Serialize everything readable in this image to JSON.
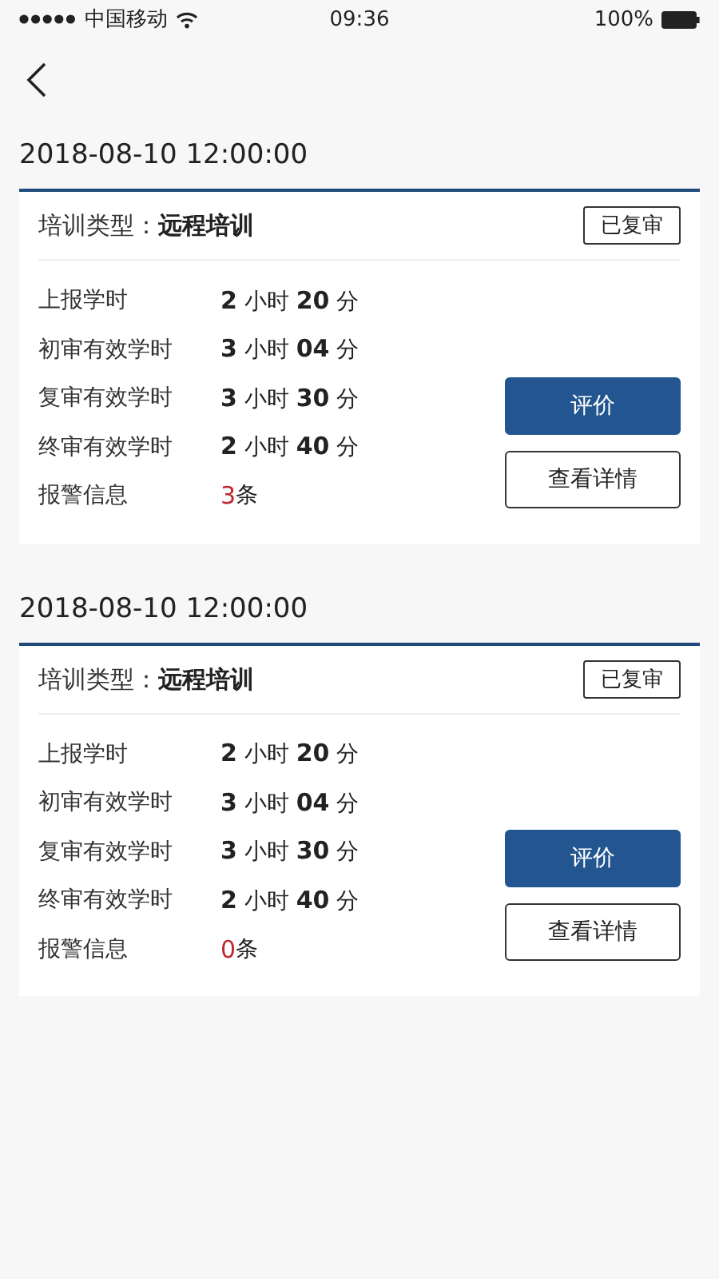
{
  "status_bar": {
    "carrier": "中国移动",
    "time": "09:36",
    "battery": "100%"
  },
  "records": [
    {
      "date": "2018-08-10  12:00:00",
      "type_label": "培训类型：",
      "type_value": "远程培训",
      "status": "已复审",
      "rows": [
        {
          "label": "上报学时",
          "value": "**2** 小时 **20** 分"
        },
        {
          "label": "初审有效学时",
          "value": "**3** 小时 **04** 分"
        },
        {
          "label": "复审有效学时",
          "value": "**3** 小时 **30** 分"
        },
        {
          "label": "终审有效学时",
          "value": "**2** 小时 **40** 分"
        }
      ],
      "alarm": {
        "label": "报警信息",
        "count": "3",
        "unit": "条"
      },
      "buttons": [
        "评价",
        "查看详情"
      ]
    },
    {
      "date": "2018-08-10  12:00:00",
      "type_label": "培训类型：",
      "type_value": "远程培训",
      "status": "已复审",
      "rows": [
        {
          "label": "上报学时",
          "value": "**2** 小时 **20** 分"
        },
        {
          "label": "初审有效学时",
          "value": "**3** 小时 **04** 分"
        },
        {
          "label": "复审有效学时",
          "value": "**3** 小时 **30** 分"
        },
        {
          "label": "终审有效学时",
          "value": "**2** 小时 **40** 分"
        }
      ],
      "alarm": {
        "label": "报警信息",
        "count": "0",
        "unit": "条"
      },
      "buttons": [
        "评价",
        "查看详情"
      ]
    }
  ]
}
